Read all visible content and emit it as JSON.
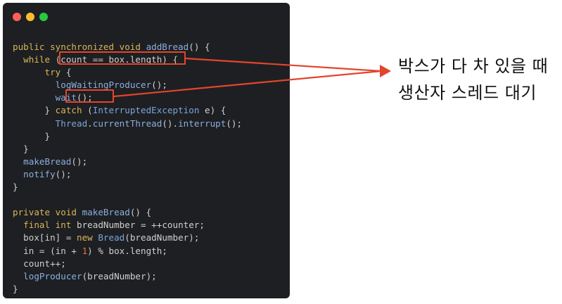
{
  "window": {
    "dot_colors": {
      "red": "#ff5f56",
      "yellow": "#ffbd2e",
      "green": "#27c93f"
    }
  },
  "code_lines": [
    [
      [
        "kw",
        "public synchronized void "
      ],
      [
        "fn",
        "addBread"
      ],
      [
        "pl",
        "() {"
      ]
    ],
    [
      [
        "pl",
        "  "
      ],
      [
        "kw",
        "while"
      ],
      [
        "pl",
        " (count == box.length) {"
      ]
    ],
    [
      [
        "pl",
        "      "
      ],
      [
        "kw",
        "try"
      ],
      [
        "pl",
        " {"
      ]
    ],
    [
      [
        "pl",
        "        "
      ],
      [
        "fn",
        "logWaitingProducer"
      ],
      [
        "pl",
        "();"
      ]
    ],
    [
      [
        "pl",
        "        "
      ],
      [
        "fn",
        "wait"
      ],
      [
        "pl",
        "();"
      ]
    ],
    [
      [
        "pl",
        "      } "
      ],
      [
        "kw",
        "catch"
      ],
      [
        "pl",
        " ("
      ],
      [
        "ty",
        "InterruptedException"
      ],
      [
        "pl",
        " e) {"
      ]
    ],
    [
      [
        "pl",
        "        "
      ],
      [
        "ty",
        "Thread"
      ],
      [
        "pl",
        "."
      ],
      [
        "fn",
        "currentThread"
      ],
      [
        "pl",
        "()."
      ],
      [
        "fn",
        "interrupt"
      ],
      [
        "pl",
        "();"
      ]
    ],
    [
      [
        "pl",
        "      }"
      ]
    ],
    [
      [
        "pl",
        "  }"
      ]
    ],
    [
      [
        "pl",
        "  "
      ],
      [
        "fn",
        "makeBread"
      ],
      [
        "pl",
        "();"
      ]
    ],
    [
      [
        "pl",
        "  "
      ],
      [
        "fn",
        "notify"
      ],
      [
        "pl",
        "();"
      ]
    ],
    [
      [
        "pl",
        "}"
      ]
    ],
    [
      [
        "pl",
        ""
      ]
    ],
    [
      [
        "kw",
        "private void "
      ],
      [
        "fn",
        "makeBread"
      ],
      [
        "pl",
        "() {"
      ]
    ],
    [
      [
        "pl",
        "  "
      ],
      [
        "kw",
        "final int"
      ],
      [
        "pl",
        " breadNumber = ++counter;"
      ]
    ],
    [
      [
        "pl",
        "  box[in] = "
      ],
      [
        "kw",
        "new "
      ],
      [
        "ty",
        "Bread"
      ],
      [
        "pl",
        "(breadNumber);"
      ]
    ],
    [
      [
        "pl",
        "  in = (in + "
      ],
      [
        "num",
        "1"
      ],
      [
        "pl",
        ") % box.length;"
      ]
    ],
    [
      [
        "pl",
        "  count++;"
      ]
    ],
    [
      [
        "pl",
        "  "
      ],
      [
        "fn",
        "logProducer"
      ],
      [
        "pl",
        "(breadNumber);"
      ]
    ],
    [
      [
        "pl",
        "}"
      ]
    ]
  ],
  "annotation": {
    "line1": "박스가 다 차 있을 때",
    "line2": "생산자 스레드 대기",
    "highlight_color": "#e2452c"
  }
}
